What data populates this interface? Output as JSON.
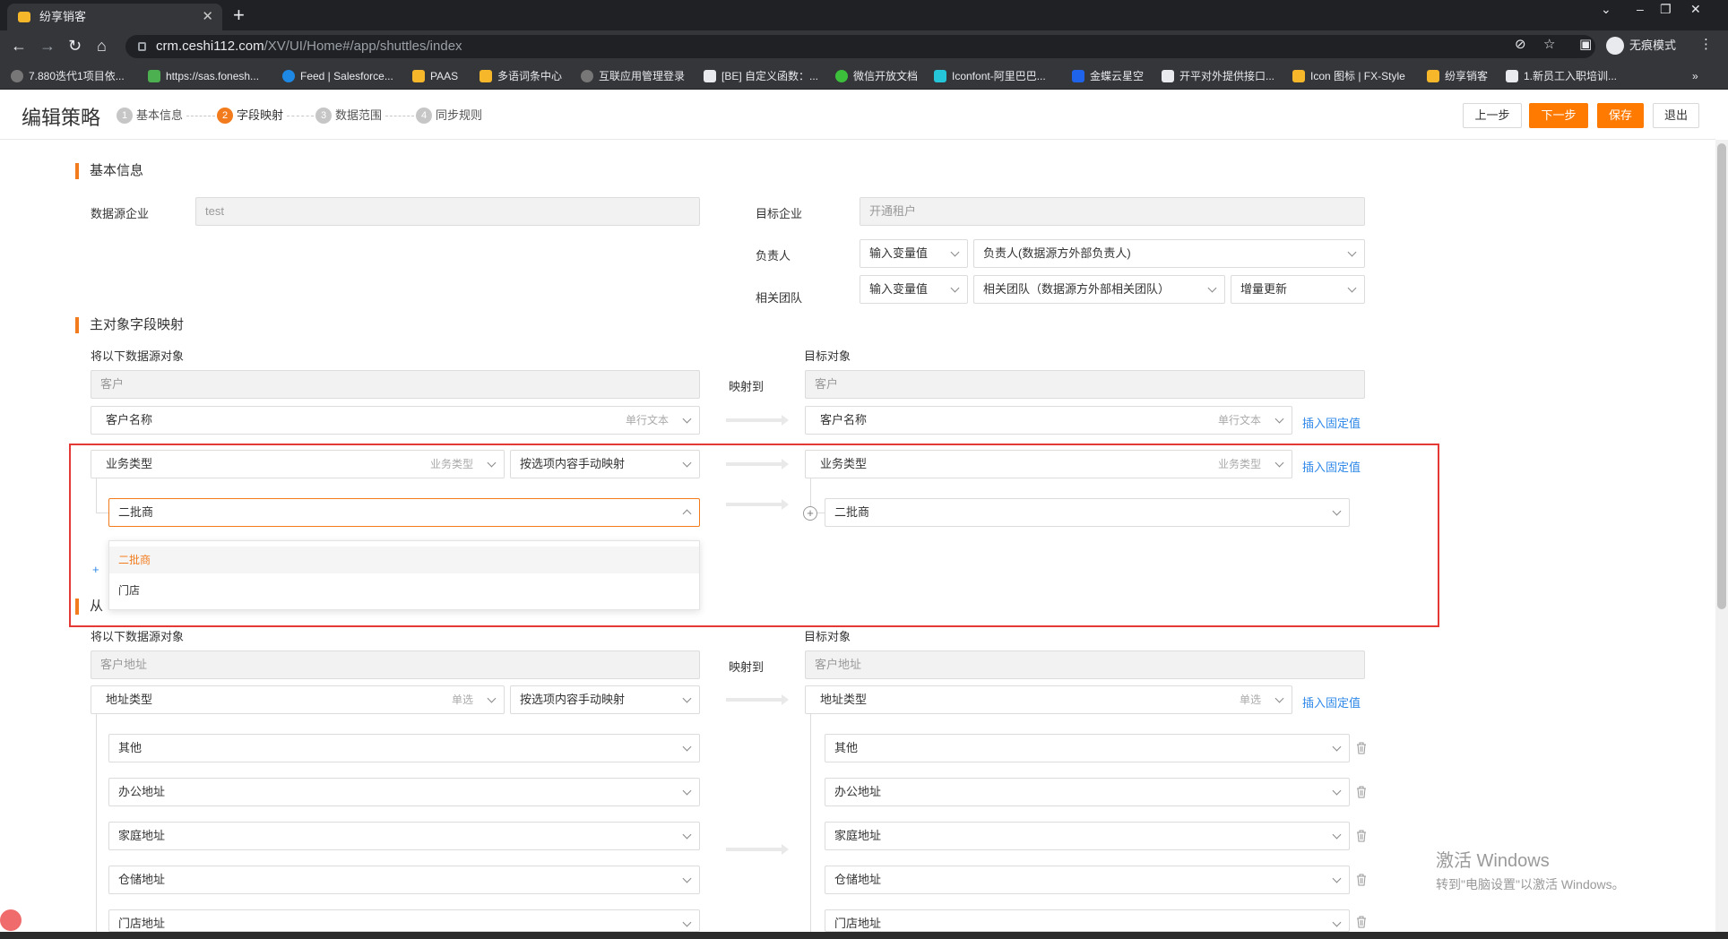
{
  "browser": {
    "tab_title": "纷享销客",
    "url_host": "crm.ceshi112.com",
    "url_path": "/XV/UI/Home#/app/shuttles/index",
    "incognito_label": "无痕模式",
    "bookmarks": [
      "7.880迭代1项目依...",
      "https://sas.fonesh...",
      "Feed | Salesforce...",
      "PAAS",
      "多语词条中心",
      "互联应用管理登录",
      "[BE] 自定义函数：...",
      "微信开放文档",
      "Iconfont-阿里巴巴...",
      "金蝶云星空",
      "开平对外提供接口...",
      "Icon 图标 | FX-Style",
      "纷享销客",
      "1.新员工入职培训..."
    ]
  },
  "header": {
    "title": "编辑策略",
    "steps": [
      {
        "num": "1",
        "label": "基本信息"
      },
      {
        "num": "2",
        "label": "字段映射"
      },
      {
        "num": "3",
        "label": "数据范围"
      },
      {
        "num": "4",
        "label": "同步规则"
      }
    ],
    "active_step": 2,
    "buttons": {
      "prev": "上一步",
      "next": "下一步",
      "save": "保存",
      "exit": "退出"
    }
  },
  "basic": {
    "section_title": "基本信息",
    "source_label": "数据源企业",
    "source_value": "test",
    "target_label": "目标企业",
    "target_value": "开通租户",
    "owner_label": "负责人",
    "owner_type": "输入变量值",
    "owner_value": "负责人(数据源方外部负责人)",
    "team_label": "相关团队",
    "team_type": "输入变量值",
    "team_value": "相关团队（数据源方外部相关团队）",
    "team_mode": "增量更新"
  },
  "main_mapping": {
    "section_title": "主对象字段映射",
    "source_header": "将以下数据源对象",
    "target_header": "目标对象",
    "map_to": "映射到",
    "source_object": "客户",
    "target_object": "客户",
    "insert_fixed": "插入固定值",
    "rows": [
      {
        "src": "客户名称",
        "src_type": "单行文本",
        "dst": "客户名称",
        "dst_type": "单行文本"
      },
      {
        "src": "业务类型",
        "src_type": "业务类型",
        "mode": "按选项内容手动映射",
        "dst": "业务类型",
        "dst_type": "业务类型"
      }
    ],
    "option_src": "二批商",
    "option_dst": "二批商",
    "dropdown_options": [
      "二批商",
      "门店"
    ],
    "add_label": "+"
  },
  "detail_mapping": {
    "section_title": "从对象字段映射",
    "section_visible": "从",
    "source_header": "将以下数据源对象",
    "target_header": "目标对象",
    "map_to": "映射到",
    "source_object": "客户地址",
    "target_object": "客户地址",
    "field_src": "地址类型",
    "field_src_type": "单选",
    "mode": "按选项内容手动映射",
    "field_dst": "地址类型",
    "field_dst_type": "单选",
    "insert_fixed": "插入固定值",
    "options": [
      {
        "src": "其他",
        "dst": "其他"
      },
      {
        "src": "办公地址",
        "dst": "办公地址"
      },
      {
        "src": "家庭地址",
        "dst": "家庭地址"
      },
      {
        "src": "仓储地址",
        "dst": "仓储地址"
      },
      {
        "src": "门店地址",
        "dst": "门店地址"
      }
    ]
  },
  "watermark": {
    "line1": "激活 Windows",
    "line2": "转到\"电脑设置\"以激活 Windows。"
  }
}
